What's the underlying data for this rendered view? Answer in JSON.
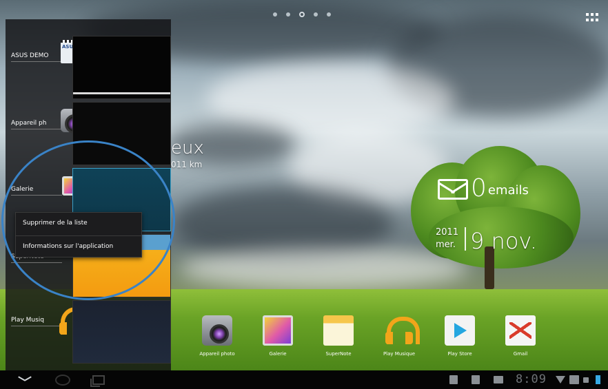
{
  "widgets": {
    "weather_city_fragment": "eux",
    "weather_sub_fragment": "011 km",
    "email": {
      "count": "0",
      "label": "emails"
    },
    "date": {
      "year": "2011",
      "weekday": "mer.",
      "day_month": "9 nov."
    }
  },
  "recent_apps": [
    {
      "label": "ASUS DEMO",
      "icon": "asus-demo-icon"
    },
    {
      "label": "Appareil ph",
      "icon": "camera-icon"
    },
    {
      "label": "Galerie",
      "icon": "gallery-icon"
    },
    {
      "label": "SuperNote",
      "icon": "supernote-icon"
    },
    {
      "label": "Play Musiq",
      "icon": "play-music-icon"
    }
  ],
  "context_menu": {
    "items": [
      "Supprimer de la liste",
      "Informations sur l'application"
    ]
  },
  "dock": [
    {
      "label": "Appareil photo",
      "icon": "camera-icon"
    },
    {
      "label": "Galerie",
      "icon": "gallery-icon"
    },
    {
      "label": "SuperNote",
      "icon": "supernote-icon"
    },
    {
      "label": "Play Musique",
      "icon": "play-music-icon"
    },
    {
      "label": "Play Store",
      "icon": "play-store-icon"
    },
    {
      "label": "Gmail",
      "icon": "gmail-icon"
    }
  ],
  "status_bar": {
    "time": "8:09"
  },
  "colors": {
    "highlight_circle": "#3a83c7",
    "battery": "#37a9e3"
  }
}
